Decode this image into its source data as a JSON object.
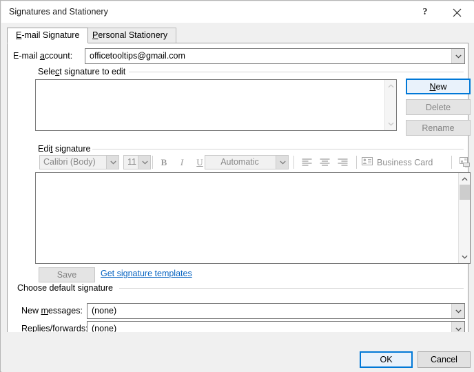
{
  "window": {
    "title": "Signatures and Stationery",
    "help_label": "?",
    "close_label": "✕"
  },
  "tabs": [
    {
      "label_before": "E",
      "label_key": "",
      "label": "E-mail Signature",
      "active": true
    },
    {
      "label": "Personal Stationery",
      "active": false
    }
  ],
  "account": {
    "label": "E-mail account:",
    "value": "officetooltips@gmail.com"
  },
  "select_signature": {
    "group_label": "Select signature to edit",
    "items": [],
    "buttons": {
      "new": "New",
      "delete": "Delete",
      "rename": "Rename"
    }
  },
  "edit_signature": {
    "group_label": "Edit signature",
    "toolbar": {
      "font_family": "Calibri (Body)",
      "font_size": "11",
      "bold": "B",
      "italic": "I",
      "underline": "U",
      "font_color": "Automatic",
      "align_left_icon": "align-left-icon",
      "align_center_icon": "align-center-icon",
      "align_right_icon": "align-right-icon",
      "business_card": "Business Card",
      "picture_icon": "picture-icon",
      "hyperlink_icon": "hyperlink-icon"
    },
    "content": "",
    "save_label": "Save",
    "templates_link": "Get signature templates"
  },
  "default_signature": {
    "group_label": "Choose default signature",
    "new_messages_label": "New messages:",
    "new_messages_value": "(none)",
    "replies_label": "Replies/forwards:",
    "replies_value": "(none)"
  },
  "footer": {
    "ok": "OK",
    "cancel": "Cancel"
  },
  "colors": {
    "accent": "#0078d7",
    "link": "#0563c1",
    "dialog_bg": "#f0f0f0",
    "panel_bg": "#ffffff",
    "disabled_text": "#838383"
  }
}
